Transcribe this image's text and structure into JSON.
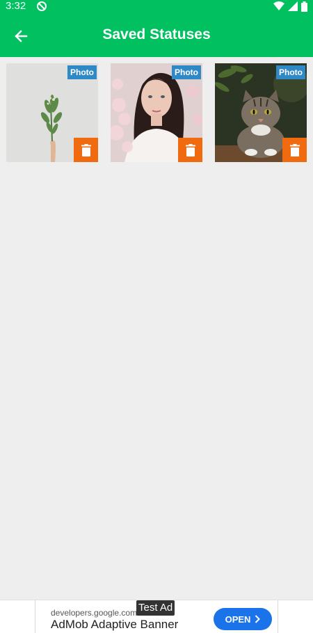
{
  "status_bar": {
    "time": "3:32",
    "icons": [
      "do-not-disturb-icon",
      "wifi-icon",
      "signal-icon",
      "battery-icon"
    ]
  },
  "app_bar": {
    "title": "Saved Statuses",
    "back_icon": "arrow-back-icon"
  },
  "statuses": [
    {
      "type_label": "Photo",
      "subject": "hand holding green plant sprig"
    },
    {
      "type_label": "Photo",
      "subject": "woman portrait with flowers"
    },
    {
      "type_label": "Photo",
      "subject": "tabby cat"
    }
  ],
  "ad": {
    "badge": "Test Ad",
    "domain": "developers.google.com",
    "headline": "AdMob Adaptive Banner",
    "cta": "OPEN"
  },
  "colors": {
    "primary": "#00c060",
    "badge": "#2e89c6",
    "delete": "#f06a10",
    "ad_button": "#1a73e8"
  }
}
